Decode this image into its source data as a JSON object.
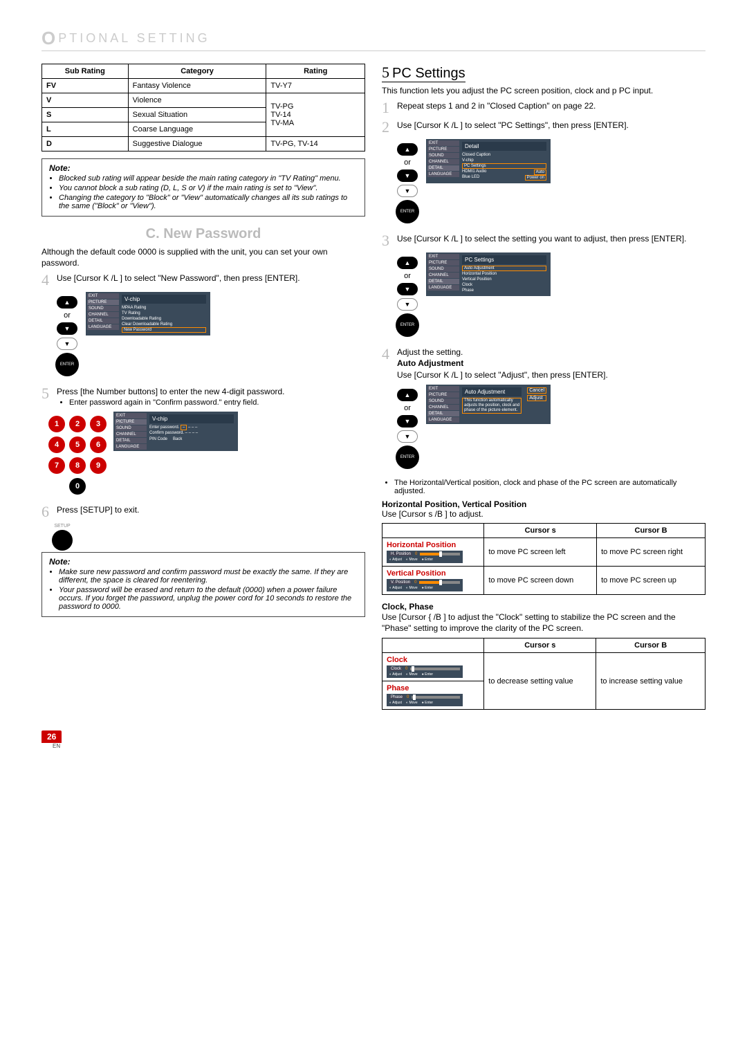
{
  "header": {
    "icon_letter": "O",
    "title": "PTIONAL  SETTING"
  },
  "left": {
    "rating_table": {
      "headers": [
        "Sub Rating",
        "Category",
        "Rating"
      ],
      "rows": [
        {
          "sub": "FV",
          "cat": "Fantasy Violence",
          "rating": "TV-Y7"
        },
        {
          "sub": "V",
          "cat": "Violence",
          "rating": "TV-PG"
        },
        {
          "sub": "S",
          "cat": "Sexual Situation",
          "rating": "TV-14"
        },
        {
          "sub": "L",
          "cat": "Coarse Language",
          "rating": "TV-MA"
        },
        {
          "sub": "D",
          "cat": "Suggestive Dialogue",
          "rating": "TV-PG, TV-14"
        }
      ]
    },
    "note1": {
      "title": "Note:",
      "items": [
        "Blocked sub rating will appear beside the main rating category in \"TV Rating\" menu.",
        "You cannot block a sub rating (D, L, S or V) if the main rating is set to \"View\".",
        "Changing the category to \"Block\" or \"View\" automatically changes all its sub ratings to the same (\"Block\" or \"View\")."
      ]
    },
    "section_c_title": "C.  New Password",
    "intro_c": "Although the default code  0000  is supplied with the unit, you can set your own password.",
    "step4_text": "Use [Cursor K /L ] to select \"New Password\", then press [ENTER].",
    "step5_text": "Press [the Number buttons] to enter the new 4-digit password.",
    "step5_bullet": "Enter password again in \"Confirm password.\" entry field.",
    "step6_text": "Press [SETUP] to exit.",
    "note2": {
      "title": "Note:",
      "items": [
        "Make sure new password and confirm password must be exactly the same. If they are different, the space is cleared for reentering.",
        "Your password will be erased and return to the default (0000) when a power failure occurs. If you forget the password, unplug the power cord for 10 seconds to restore the password to 0000."
      ]
    },
    "remote": {
      "or": "or",
      "enter": "ENTER",
      "setup_label": "SETUP"
    },
    "numpad": [
      "1",
      "2",
      "3",
      "4",
      "5",
      "6",
      "7",
      "8",
      "9",
      "0"
    ],
    "osd_vchip": {
      "header": "V-chip",
      "menu": [
        "EXIT",
        "PICTURE",
        "SOUND",
        "CHANNEL",
        "DETAIL",
        "LANGUAGE"
      ],
      "lines": [
        "MPAA Rating",
        "TV Rating",
        "Downloadable Rating",
        "Clear Downloadable Rating"
      ],
      "selected": "New Password"
    },
    "osd_pw": {
      "header": "V-chip",
      "menu": [
        "EXIT",
        "PICTURE",
        "SOUND",
        "CHANNEL",
        "DETAIL",
        "LANGUAGE"
      ],
      "enter_label": "Enter password.",
      "confirm_label": "Confirm password.",
      "pin": "PIN Code",
      "back": "Back"
    }
  },
  "right": {
    "section5_num": "5",
    "section5_title": "PC Settings",
    "intro5": "This function lets you adjust the PC screen position, clock and p PC input.",
    "step1": "Repeat steps 1 and 2 in \"Closed Caption\" on page 22.",
    "step2": "Use [Cursor K /L ] to select \"PC Settings\", then press [ENTER].",
    "step3": "Use [Cursor K /L ] to select the setting you want to adjust, then press [ENTER].",
    "step4": "Adjust the setting.",
    "auto_head": "Auto Adjustment",
    "auto_body": "Use [Cursor K /L ] to select \"Adjust\", then press [ENTER].",
    "auto_bullet": "The Horizontal/Vertical position, clock and phase of the PC screen are automatically adjusted.",
    "hv_head": "Horizontal Position, Vertical Position",
    "hv_body": "Use [Cursor s  /B ] to adjust.",
    "adj_table": {
      "headers": [
        "",
        "Cursor s",
        "Cursor B"
      ],
      "rows": [
        {
          "head": "Horizontal Position",
          "mini_label": "H. Position",
          "left": "to move PC screen left",
          "right": "to move PC screen right"
        },
        {
          "head": "Vertical Position",
          "mini_label": "V. Position",
          "left": "to move PC screen down",
          "right": "to move PC screen up"
        }
      ]
    },
    "clock_head": "Clock, Phase",
    "clock_body": "Use [Cursor {  /B ] to adjust the \"Clock\" setting to stabilize the PC screen and the \"Phase\" setting to improve the clarity of the PC screen.",
    "clock_table": {
      "headers": [
        "",
        "Cursor s",
        "Cursor B"
      ],
      "rows": [
        {
          "head": "Clock",
          "mini_label": "Clock",
          "left": "to decrease setting value",
          "right": "to increase setting value"
        },
        {
          "head": "Phase",
          "mini_label": "Phase",
          "left": "",
          "right": ""
        }
      ]
    },
    "mini_legend": {
      "adjust": "Adjust",
      "move": "Move",
      "enter": "Enter"
    },
    "osd_detail": {
      "header": "Detail",
      "menu": [
        "EXIT",
        "PICTURE",
        "SOUND",
        "CHANNEL",
        "DETAIL",
        "LANGUAGE"
      ],
      "lines": [
        "Closed Caption",
        "V-chip"
      ],
      "selected": "PC Settings",
      "hdmi": "HDMI1 Audio",
      "hdmi_val": "Auto",
      "led": "Blue LED",
      "led_val": "Power on"
    },
    "osd_pcsettings": {
      "header": "PC Settings",
      "menu": [
        "EXIT",
        "PICTURE",
        "SOUND",
        "CHANNEL",
        "DETAIL",
        "LANGUAGE"
      ],
      "selected": "Auto Adjustment",
      "lines": [
        "Horizontal Position",
        "Vertical Position",
        "Clock",
        "Phase"
      ]
    },
    "osd_auto": {
      "header": "Auto Adjustment",
      "menu": [
        "EXIT",
        "PICTURE",
        "SOUND",
        "CHANNEL",
        "DETAIL",
        "LANGUAGE"
      ],
      "msg": "This function automatically adjusts the position, clock and phase of the picture element.",
      "cancel": "Cancel",
      "adjust": "Adjust"
    },
    "remote": {
      "or": "or",
      "enter": "ENTER"
    }
  },
  "footer": {
    "page": "26",
    "lang": "EN"
  }
}
